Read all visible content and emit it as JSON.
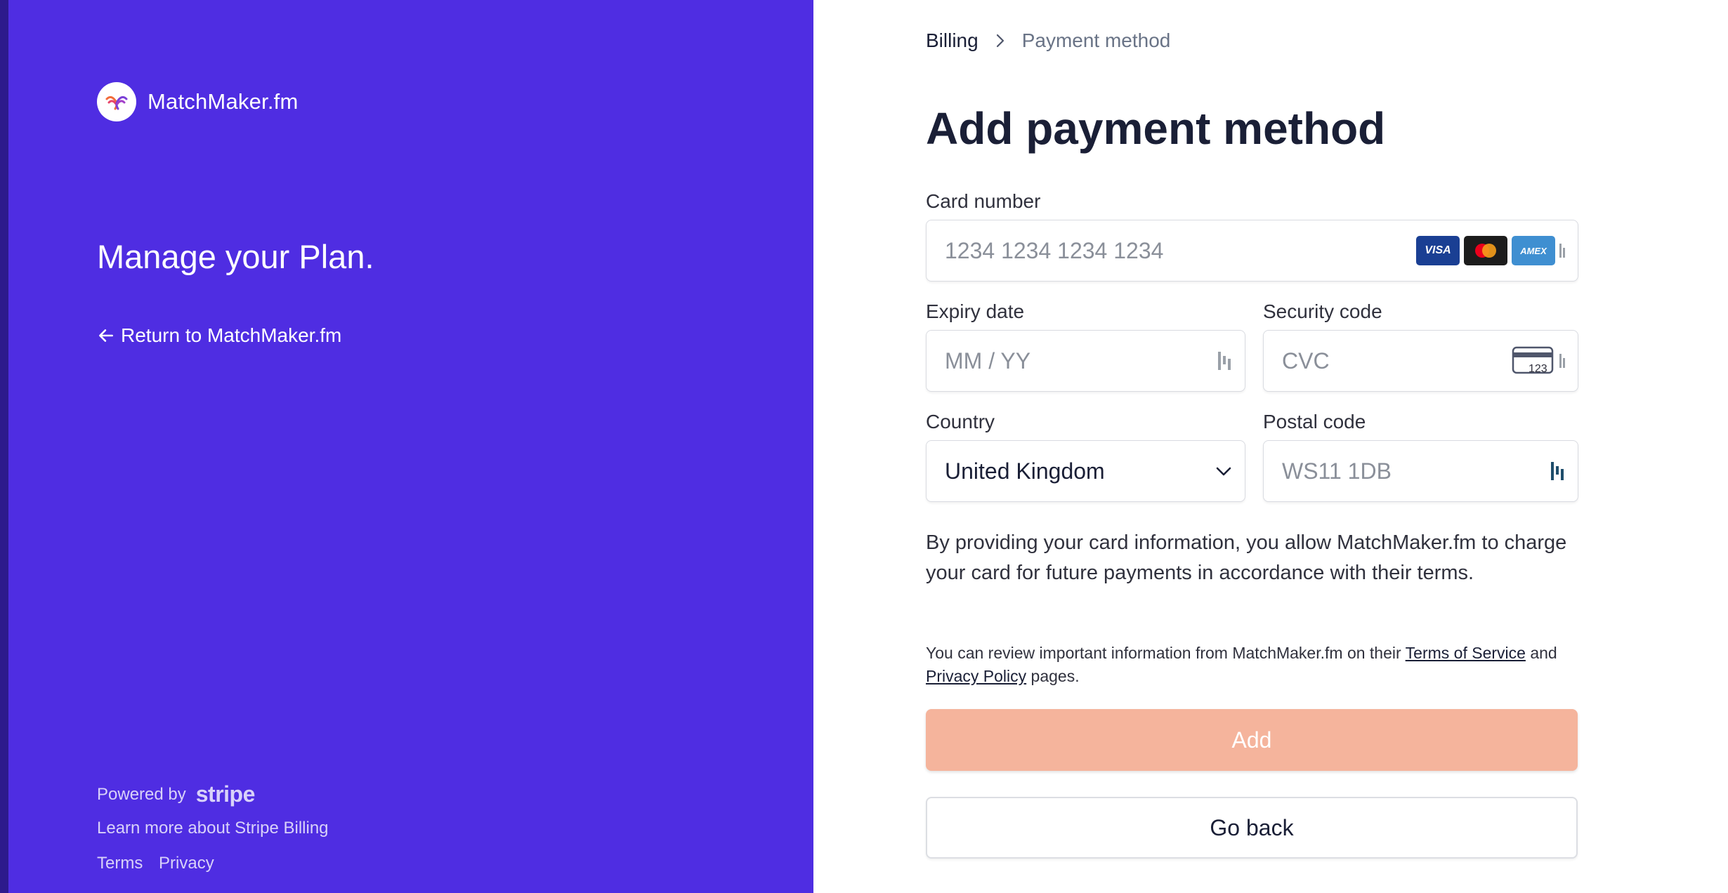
{
  "sidebar": {
    "brand_name": "MatchMaker.fm",
    "tagline": "Manage your Plan.",
    "return_link": "Return to MatchMaker.fm",
    "powered_by": "Powered by",
    "stripe_wordmark": "stripe",
    "learn_more": "Learn more about Stripe Billing",
    "terms": "Terms",
    "privacy": "Privacy",
    "background_color": "#4f2de2"
  },
  "breadcrumb": {
    "parent": "Billing",
    "current": "Payment method"
  },
  "form": {
    "title": "Add payment method",
    "card_number": {
      "label": "Card number",
      "placeholder": "1234 1234 1234 1234",
      "brands": [
        "VISA",
        "Mastercard",
        "AMEX"
      ]
    },
    "expiry": {
      "label": "Expiry date",
      "placeholder": "MM / YY"
    },
    "security": {
      "label": "Security code",
      "placeholder": "CVC",
      "icon_text": "123"
    },
    "country": {
      "label": "Country",
      "value": "United Kingdom"
    },
    "postal": {
      "label": "Postal code",
      "placeholder": "WS11 1DB"
    },
    "consent": "By providing your card information, you allow MatchMaker.fm to charge your card for future payments in accordance with their terms.",
    "review_prefix": "You can review important information from MatchMaker.fm on their",
    "terms_link": "Terms of Service",
    "review_and": "and",
    "privacy_link": "Privacy Policy",
    "review_suffix": "pages.",
    "add_button": "Add",
    "back_button": "Go back",
    "add_button_color": "#f5b49c"
  }
}
